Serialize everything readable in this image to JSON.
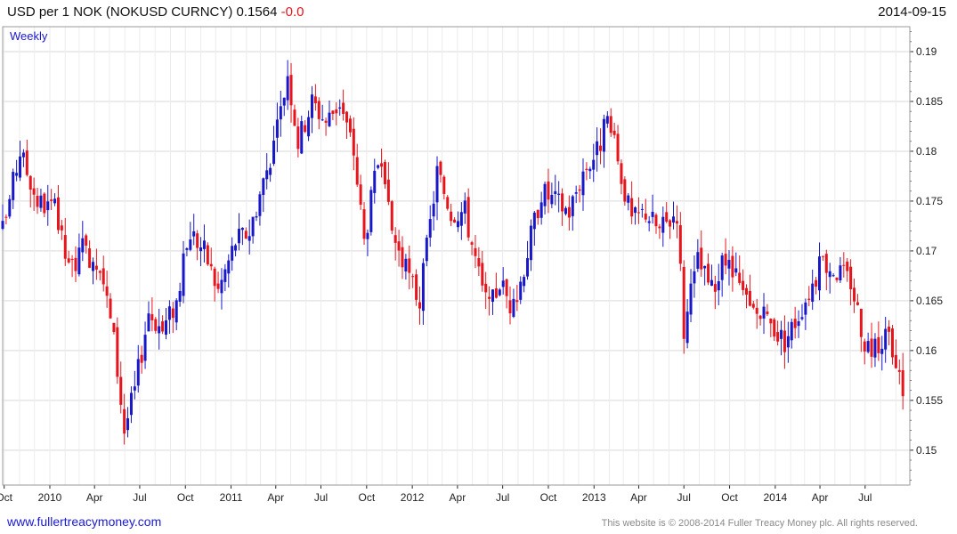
{
  "header": {
    "title": "USD per 1 NOK (NOKUSD CURNCY)",
    "last": "0.1564",
    "change": "-0.0",
    "date": "2014-09-15"
  },
  "footer": {
    "site": "www.fullertreacymoney.com",
    "copyright": "This website is © 2008-2014 Fuller Treacy Money plc. All rights reserved."
  },
  "colors": {
    "up": "#1818c8",
    "down": "#e8141c",
    "grid": "#d9d9d9",
    "axis": "#222222",
    "period": "#1a1ad0"
  },
  "chart_data": {
    "type": "candlestick",
    "period_label": "Weekly",
    "x_ticks": [
      {
        "label": "Oct",
        "date": "2009-10"
      },
      {
        "label": "2010",
        "date": "2010-01"
      },
      {
        "label": "Apr",
        "date": "2010-04"
      },
      {
        "label": "Jul",
        "date": "2010-07"
      },
      {
        "label": "Oct",
        "date": "2010-10"
      },
      {
        "label": "2011",
        "date": "2011-01"
      },
      {
        "label": "Apr",
        "date": "2011-04"
      },
      {
        "label": "Jul",
        "date": "2011-07"
      },
      {
        "label": "Oct",
        "date": "2011-10"
      },
      {
        "label": "2012",
        "date": "2012-01"
      },
      {
        "label": "Apr",
        "date": "2012-04"
      },
      {
        "label": "Jul",
        "date": "2012-07"
      },
      {
        "label": "Oct",
        "date": "2012-10"
      },
      {
        "label": "2013",
        "date": "2013-01"
      },
      {
        "label": "Apr",
        "date": "2013-04"
      },
      {
        "label": "Jul",
        "date": "2013-07"
      },
      {
        "label": "Oct",
        "date": "2013-10"
      },
      {
        "label": "2014",
        "date": "2014-01"
      },
      {
        "label": "Apr",
        "date": "2014-04"
      },
      {
        "label": "Jul",
        "date": "2014-07"
      }
    ],
    "y_ticks": [
      "0.15",
      "0.155",
      "0.16",
      "0.165",
      "0.17",
      "0.175",
      "0.18",
      "0.185",
      "0.19"
    ],
    "ylim": [
      0.1465,
      0.1925
    ],
    "x_range": [
      "2009-09-28",
      "2014-09-29"
    ],
    "grid": true,
    "close_anchors": [
      [
        "2009-09-28",
        0.172
      ],
      [
        "2009-11-02",
        0.18
      ],
      [
        "2009-12-07",
        0.175
      ],
      [
        "2010-01-11",
        0.174
      ],
      [
        "2010-02-08",
        0.168
      ],
      [
        "2010-03-08",
        0.17
      ],
      [
        "2010-04-12",
        0.169
      ],
      [
        "2010-05-10",
        0.161
      ],
      [
        "2010-05-31",
        0.152
      ],
      [
        "2010-06-21",
        0.156
      ],
      [
        "2010-07-19",
        0.164
      ],
      [
        "2010-08-16",
        0.162
      ],
      [
        "2010-09-13",
        0.165
      ],
      [
        "2010-10-11",
        0.172
      ],
      [
        "2010-11-08",
        0.17
      ],
      [
        "2010-12-06",
        0.166
      ],
      [
        "2011-01-10",
        0.171
      ],
      [
        "2011-02-07",
        0.172
      ],
      [
        "2011-03-07",
        0.177
      ],
      [
        "2011-04-04",
        0.182
      ],
      [
        "2011-04-25",
        0.188
      ],
      [
        "2011-05-16",
        0.181
      ],
      [
        "2011-06-13",
        0.185
      ],
      [
        "2011-07-11",
        0.183
      ],
      [
        "2011-08-08",
        0.185
      ],
      [
        "2011-09-05",
        0.18
      ],
      [
        "2011-09-26",
        0.171
      ],
      [
        "2011-10-24",
        0.179
      ],
      [
        "2011-11-21",
        0.172
      ],
      [
        "2011-12-19",
        0.168
      ],
      [
        "2012-01-16",
        0.165
      ],
      [
        "2012-02-20",
        0.178
      ],
      [
        "2012-03-19",
        0.174
      ],
      [
        "2012-04-16",
        0.174
      ],
      [
        "2012-05-21",
        0.166
      ],
      [
        "2012-06-04",
        0.164
      ],
      [
        "2012-06-25",
        0.167
      ],
      [
        "2012-07-23",
        0.164
      ],
      [
        "2012-08-20",
        0.17
      ],
      [
        "2012-09-17",
        0.176
      ],
      [
        "2012-10-15",
        0.175
      ],
      [
        "2012-11-12",
        0.174
      ],
      [
        "2012-12-10",
        0.178
      ],
      [
        "2013-01-07",
        0.18
      ],
      [
        "2013-01-28",
        0.183
      ],
      [
        "2013-02-18",
        0.179
      ],
      [
        "2013-03-18",
        0.173
      ],
      [
        "2013-04-15",
        0.174
      ],
      [
        "2013-05-13",
        0.172
      ],
      [
        "2013-06-17",
        0.174
      ],
      [
        "2013-07-01",
        0.162
      ],
      [
        "2013-07-29",
        0.169
      ],
      [
        "2013-08-26",
        0.166
      ],
      [
        "2013-09-23",
        0.169
      ],
      [
        "2013-10-14",
        0.167
      ],
      [
        "2013-11-11",
        0.164
      ],
      [
        "2013-12-16",
        0.163
      ],
      [
        "2014-01-20",
        0.161
      ],
      [
        "2014-02-10",
        0.163
      ],
      [
        "2014-03-10",
        0.166
      ],
      [
        "2014-04-07",
        0.169
      ],
      [
        "2014-05-05",
        0.168
      ],
      [
        "2014-06-02",
        0.167
      ],
      [
        "2014-06-30",
        0.161
      ],
      [
        "2014-07-21",
        0.16
      ],
      [
        "2014-08-11",
        0.162
      ],
      [
        "2014-09-01",
        0.158
      ],
      [
        "2014-09-15",
        0.1564
      ]
    ]
  }
}
